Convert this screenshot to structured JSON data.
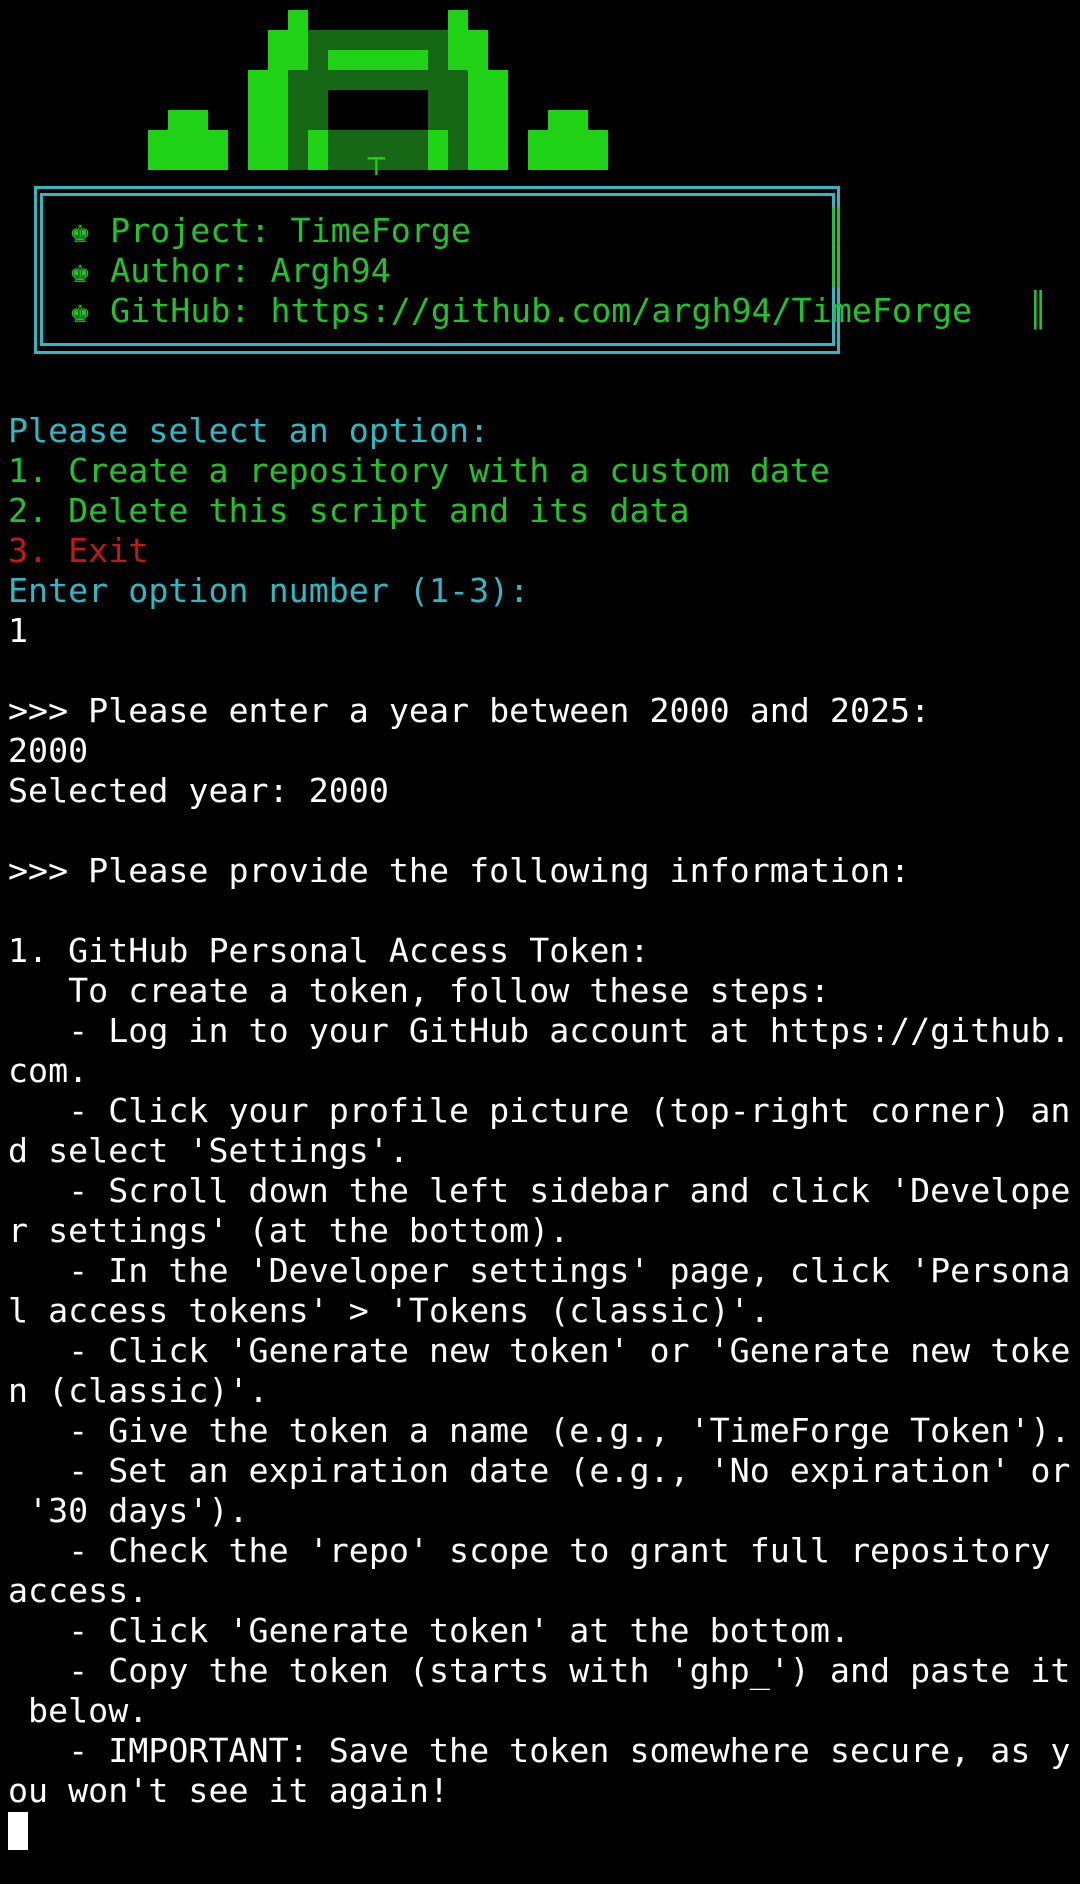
{
  "header": {
    "project": "♚ Project: TimeForge",
    "author": "♚ Author: Argh94",
    "github": "♚ GitHub: https://github.com/argh94/TimeForge",
    "bar": "║"
  },
  "menu": {
    "prompt": "Please select an option:",
    "option1": "1. Create a repository with a custom date",
    "option2": "2. Delete this script and its data",
    "option3": "3. Exit",
    "enter": "Enter option number (1-3):",
    "input": "1"
  },
  "year": {
    "prompt": ">>> Please enter a year between 2000 and 2025:",
    "input": "2000",
    "selected": "Selected year: 2000"
  },
  "info": {
    "prompt": ">>> Please provide the following information:",
    "token_title": "1. GitHub Personal Access Token:",
    "lines": [
      "   To create a token, follow these steps:",
      "   - Log in to your GitHub account at https://github.",
      "com.",
      "   - Click your profile picture (top-right corner) an",
      "d select 'Settings'.",
      "   - Scroll down the left sidebar and click 'Develope",
      "r settings' (at the bottom).",
      "   - In the 'Developer settings' page, click 'Persona",
      "l access tokens' > 'Tokens (classic)'.",
      "   - Click 'Generate new token' or 'Generate new toke",
      "n (classic)'.",
      "   - Give the token a name (e.g., 'TimeForge Token').",
      "   - Set an expiration date (e.g., 'No expiration' or",
      " '30 days').",
      "   - Check the 'repo' scope to grant full repository",
      "access.",
      "   - Click 'Generate token' at the bottom.",
      "   - Copy the token (starts with 'ghp_') and paste it",
      " below.",
      "   - IMPORTANT: Save the token somewhere secure, as y",
      "ou won't see it again!"
    ]
  },
  "logo_glyph": "┬",
  "colors": {
    "green": "#22c32a",
    "cyan": "#2fb8c2",
    "red": "#c21818",
    "white": "#ffffff",
    "background": "#000000"
  }
}
